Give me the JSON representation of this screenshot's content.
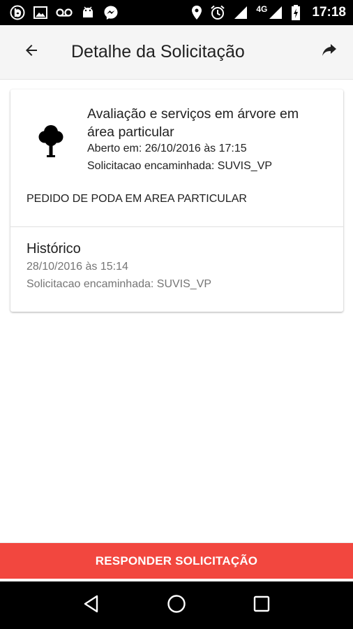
{
  "status_bar": {
    "time": "17:18",
    "network": "4G",
    "icons": [
      "b-app-icon",
      "image-icon",
      "voicemail-icon",
      "android-icon",
      "messenger-icon",
      "location-icon",
      "alarm-icon",
      "signal-icon",
      "signal-4g-icon",
      "battery-icon"
    ]
  },
  "app_bar": {
    "title": "Detalhe da Solicitação",
    "back_icon": "arrow-back-icon",
    "share_icon": "share-icon"
  },
  "request": {
    "icon": "tree-icon",
    "title": "Avaliação e serviços em árvore em área particular",
    "opened": "Aberto em: 26/10/2016 às 17:15",
    "forwarded": "Solicitacao encaminhada: SUVIS_VP",
    "description": "PEDIDO DE PODA EM AREA PARTICULAR"
  },
  "history": {
    "heading": "Histórico",
    "date": "28/10/2016 às 15:14",
    "status": "Solicitacao encaminhada: SUVIS_VP"
  },
  "actions": {
    "respond_label": "RESPONDER SOLICITAÇÃO"
  },
  "colors": {
    "accent": "#f2473f",
    "app_bar": "#f5f5f5",
    "secondary_text": "#757575"
  }
}
